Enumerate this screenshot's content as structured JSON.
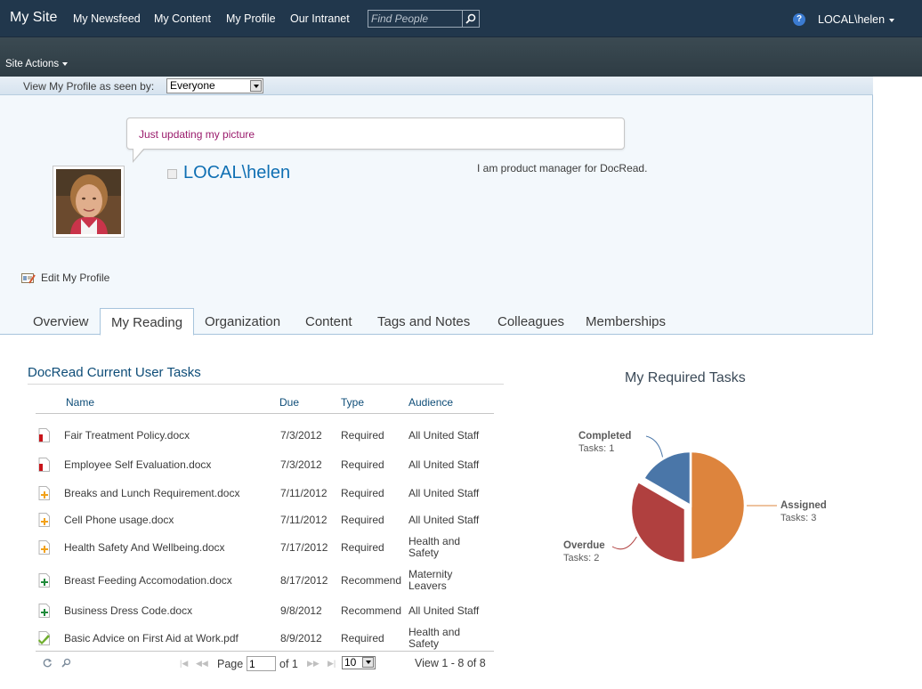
{
  "topbar": {
    "site_title": "My Site",
    "nav": [
      "My Newsfeed",
      "My Content",
      "My Profile",
      "Our Intranet"
    ],
    "search_placeholder": "Find People",
    "user": "LOCAL\\helen"
  },
  "ribbon": {
    "site_actions": "Site Actions"
  },
  "view_bar": {
    "label": "View My Profile as seen by:",
    "selected": "Everyone"
  },
  "profile": {
    "status": "Just updating my picture",
    "name": "LOCAL\\helen",
    "about": "I am product manager for DocRead.",
    "edit_link": "Edit My Profile"
  },
  "tabs": [
    {
      "label": "Overview",
      "active": false
    },
    {
      "label": "My Reading",
      "active": true
    },
    {
      "label": "Organization",
      "active": false
    },
    {
      "label": "Content",
      "active": false
    },
    {
      "label": "Tags and Notes",
      "active": false
    },
    {
      "label": "Colleagues",
      "active": false
    },
    {
      "label": "Memberships",
      "active": false
    }
  ],
  "tasks": {
    "title": "DocRead Current User Tasks",
    "columns": [
      "Name",
      "Due",
      "Type",
      "Audience"
    ],
    "rows": [
      {
        "icon": "overdue-doc-icon",
        "name": "Fair Treatment Policy.docx",
        "due": "7/3/2012",
        "type": "Required",
        "audience": "All United Staff"
      },
      {
        "icon": "overdue-doc-icon",
        "name": "Employee Self Evaluation.docx",
        "due": "7/3/2012",
        "type": "Required",
        "audience": "All United Staff"
      },
      {
        "icon": "assigned-doc-icon",
        "name": "Breaks and Lunch Requirement.docx",
        "due": "7/11/2012",
        "type": "Required",
        "audience": "All United Staff"
      },
      {
        "icon": "assigned-doc-icon",
        "name": "Cell Phone usage.docx",
        "due": "7/11/2012",
        "type": "Required",
        "audience": "All United Staff"
      },
      {
        "icon": "assigned-doc-icon",
        "name": "Health Safety And Wellbeing.docx",
        "due": "7/17/2012",
        "type": "Required",
        "audience": "Health and Safety"
      },
      {
        "icon": "recommended-doc-icon",
        "name": "Breast Feeding Accomodation.docx",
        "due": "8/17/2012",
        "type": "Recommend",
        "audience": "Maternity Leavers"
      },
      {
        "icon": "recommended-doc-icon",
        "name": "Business Dress Code.docx",
        "due": "9/8/2012",
        "type": "Recommend",
        "audience": "All United Staff"
      },
      {
        "icon": "completed-doc-icon",
        "name": "Basic Advice on First Aid at Work.pdf",
        "due": "8/9/2012",
        "type": "Required",
        "audience": "Health and Safety"
      }
    ],
    "pager": {
      "page_label": "Page",
      "page_value": "1",
      "of_label": "of 1",
      "page_size": "10",
      "summary": "View 1 - 8 of 8"
    }
  },
  "chart_data": {
    "type": "pie",
    "title": "My Required Tasks",
    "slices": [
      {
        "name": "Assigned",
        "detail": "Tasks: 3",
        "value": 3,
        "color": "#dd843d"
      },
      {
        "name": "Overdue",
        "detail": "Tasks: 2",
        "value": 2,
        "color": "#b0403f",
        "exploded": true
      },
      {
        "name": "Completed",
        "detail": "Tasks: 1",
        "value": 1,
        "color": "#4a76a8"
      }
    ]
  }
}
